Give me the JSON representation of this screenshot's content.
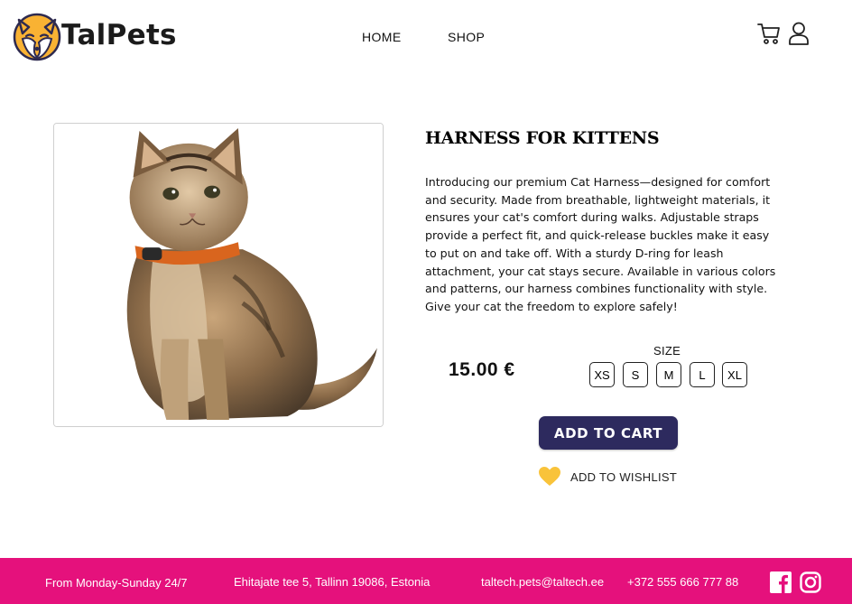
{
  "brand": {
    "name": "TalPets",
    "accent": "#f9b233"
  },
  "nav": {
    "items": [
      {
        "label": "HOME"
      },
      {
        "label": "SHOP"
      }
    ]
  },
  "header_icons": {
    "cart": "shopping-cart-icon",
    "user": "user-icon"
  },
  "product": {
    "image_alt": "cat-photo",
    "title": "HARNESS FOR KITTENS",
    "description": "Introducing our premium Cat Harness—designed for comfort and security. Made from breathable, lightweight materials, it ensures your cat's comfort during walks. Adjustable straps provide a perfect fit, and quick-release buckles make it easy to put on and take off. With a sturdy D-ring for leash attachment, your cat stays secure. Available in various colors and patterns, our harness combines functionality with style. Give your cat the freedom to explore safely!",
    "price": "15.00 €",
    "size_label": "SIZE",
    "sizes": [
      "XS",
      "S",
      "M",
      "L",
      "XL"
    ],
    "add_to_cart_label": "ADD TO CART",
    "wishlist_label": "ADD TO WISHLIST",
    "cart_button_color": "#2d2a5e",
    "wishlist_icon_color": "#f9c33a"
  },
  "footer": {
    "background": "#e5117c",
    "hours": "From Monday-Sunday 24/7",
    "address": "Ehitajate tee 5, Tallinn 19086, Estonia",
    "email": "taltech.pets@taltech.ee",
    "phone": "+372 555 666 777 88",
    "social_icons": [
      "facebook-icon",
      "instagram-icon"
    ]
  }
}
